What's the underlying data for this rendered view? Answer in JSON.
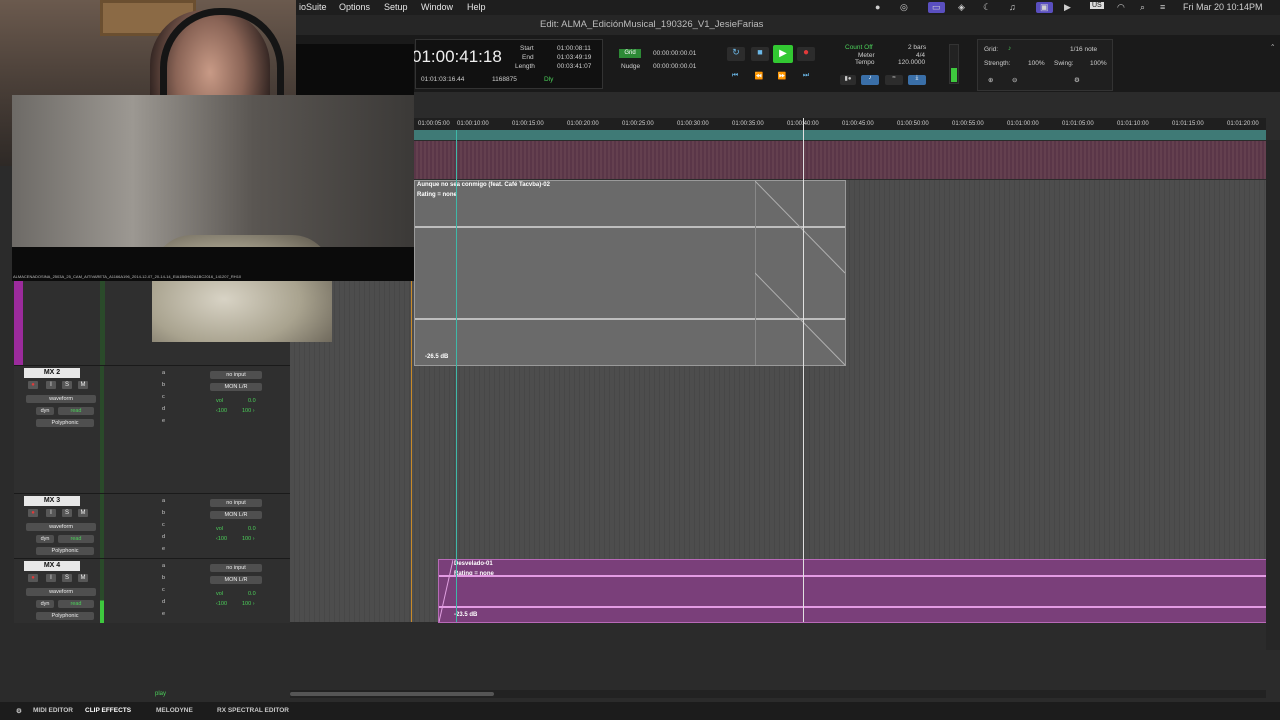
{
  "menubar": {
    "app_fragment": "ioSuite",
    "items": [
      "Options",
      "Setup",
      "Window",
      "Help"
    ],
    "input_badge": "US",
    "datetime": "Fri Mar 20  10:14PM"
  },
  "window": {
    "title": "Edit: ALMA_EdiciónMusical_190326_V1_JesieFarias"
  },
  "transport": {
    "main_counter": "01:00:41:18",
    "start_label": "Start",
    "end_label": "End",
    "length_label": "Length",
    "start": "01:00:08:11",
    "end": "01:03:49:19",
    "length": "00:03:41:07",
    "sub_counter": "01:01:03:16.44",
    "samples": "1168875",
    "dly_label": "Dly",
    "grid_label": "Grid",
    "grid_value": "00:00:00:00.01",
    "nudge_label": "Nudge",
    "nudge_value": "00:00:00:00.01",
    "count_off": "Count Off",
    "meter_label": "Meter",
    "tempo_label": "Tempo",
    "bars": "2 bars",
    "meter_value": "4/4",
    "tempo_value": "120.0000",
    "grid2_label": "Grid:",
    "grid2_value": "1/16 note",
    "strength_label": "Strength:",
    "strength_value": "100%",
    "swing_label": "Swing:",
    "swing_value": "100%"
  },
  "ruler": {
    "ticks": [
      "01:00:05:00",
      "01:00:10:00",
      "01:00:15:00",
      "01:00:20:00",
      "01:00:25:00",
      "01:00:30:00",
      "01:00:35:00",
      "01:00:40:00",
      "01:00:45:00",
      "01:00:50:00",
      "01:00:55:00",
      "01:01:00:00",
      "01:01:05:00",
      "01:01:10:00",
      "01:01:15:00",
      "01:01:20:00"
    ]
  },
  "video": {
    "filename": "ALMACENADOSINA_2503A_25_CAM_AITIVARETA_A1166A196_2014-12-07_20-14-14_EIA1B6H62A1BC2016_141207_RH10"
  },
  "tracks": [
    {
      "name": "MX 2",
      "view": "waveform",
      "dyn": "dyn",
      "automation": "read",
      "algo": "Polyphonic",
      "input": "no input",
      "output": "MON L/R",
      "vol_label": "vol",
      "vol": "0.0",
      "pan_l": "‹100",
      "pan_r": "100 ›",
      "sends": [
        "a",
        "b",
        "c",
        "d",
        "e"
      ]
    },
    {
      "name": "MX 3",
      "view": "waveform",
      "dyn": "dyn",
      "automation": "read",
      "algo": "Polyphonic",
      "input": "no input",
      "output": "MON L/R",
      "vol_label": "vol",
      "vol": "0.0",
      "pan_l": "‹100",
      "pan_r": "100 ›",
      "sends": [
        "a",
        "b",
        "c",
        "d",
        "e"
      ]
    },
    {
      "name": "MX 4",
      "view": "waveform",
      "dyn": "dyn",
      "automation": "read",
      "algo": "Polyphonic",
      "input": "no input",
      "output": "MON L/R",
      "vol_label": "vol",
      "vol": "0.0",
      "pan_l": "‹100",
      "pan_r": "100 ›",
      "sends": [
        "a",
        "b",
        "c",
        "d",
        "e"
      ]
    }
  ],
  "track_buttons": {
    "rec": "●",
    "input": "I",
    "solo": "S",
    "mute": "M"
  },
  "clips": [
    {
      "title": "Aunque no sea conmigo (feat. Café Tacvba)-02",
      "rating": "Rating = none",
      "gain": "-26.5 dB"
    },
    {
      "title": "Desvelado-01",
      "rating": "Rating = none",
      "gain": "-23.5 dB"
    }
  ],
  "status": {
    "play": "play"
  },
  "bottom_tabs": [
    "MIDI EDITOR",
    "CLIP EFFECTS",
    "MELODYNE",
    "RX SPECTRAL EDITOR"
  ],
  "colors": {
    "accent_green": "#4cd05a",
    "track_purple": "#9b2b9c",
    "clip_pink": "#c86ac8",
    "marker_teal": "#3f7a76"
  }
}
